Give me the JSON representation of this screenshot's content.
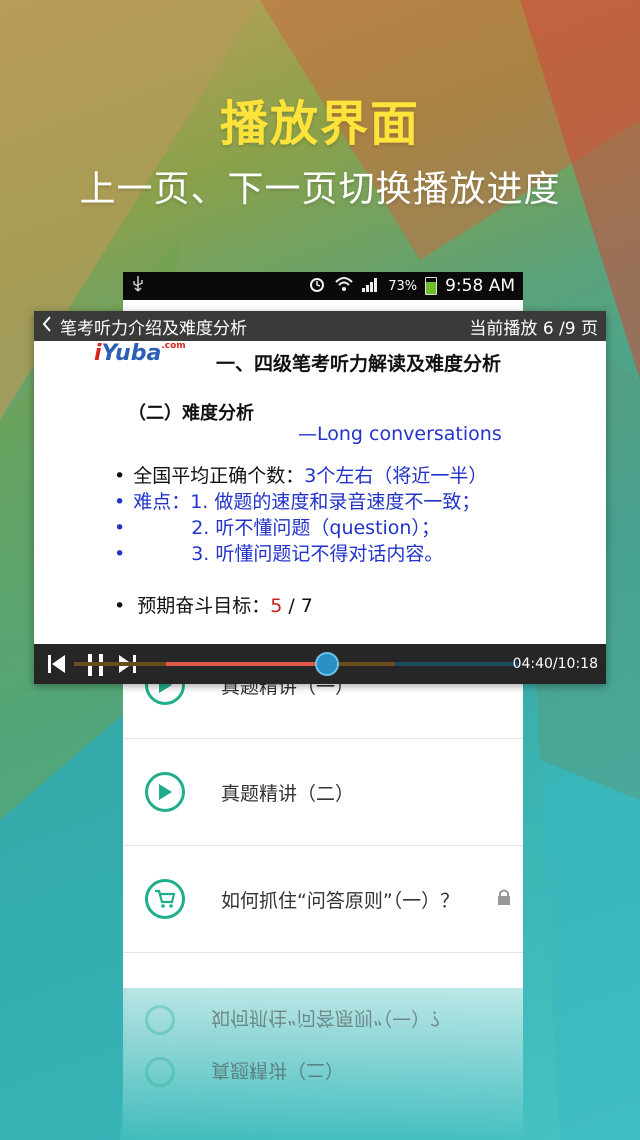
{
  "hero": {
    "title": "播放界面",
    "subtitle": "上一页、下一页切换播放进度"
  },
  "status_bar": {
    "battery_text": "73%",
    "battery_level": 0.73,
    "time": "9:58 AM",
    "icons": [
      "usb-icon",
      "alarm-icon",
      "wifi-icon",
      "signal-icon",
      "battery-charging-icon"
    ]
  },
  "player": {
    "back_title": "笔考听力介绍及难度分析",
    "page_label": "当前播放 6 /9 页",
    "current_time": "04:40/10:18",
    "progress": 0.457,
    "buffer": 0.65
  },
  "slide": {
    "logo": {
      "text": "Yuba",
      "suffix": ".com"
    },
    "title": "一、四级笔考听力解读及难度分析",
    "section": "（二）难度分析",
    "subsection": "—Long conversations",
    "bullet1": {
      "label": "全国平均正确个数：",
      "value": "3个左右（将近一半）"
    },
    "bullet2": "难点：1. 做题的速度和录音速度不一致；",
    "bullet3": "2. 听不懂问题（question）；",
    "bullet4": "3. 听懂问题记不得对话内容。",
    "bullet5": {
      "label": "预期奋斗目标：",
      "value_red": "5",
      "value_rest": " / 7"
    },
    "colors": {
      "blue": "#2233cc",
      "red": "#cc1f1f",
      "black": "#111111"
    }
  },
  "list": {
    "items": [
      {
        "label": "真题精讲（一）",
        "icon": "play-circle-icon"
      },
      {
        "label": "真题精讲（二）",
        "icon": "play-circle-icon"
      },
      {
        "label": "如何抓住“问答原则”（一）？",
        "icon": "cart-circle-icon",
        "locked": true
      }
    ]
  },
  "reflection": {
    "row1": "如何抓住“问答原则”（一）？",
    "row2": "真题精讲（二）"
  },
  "accent_color": "#1fae8c"
}
